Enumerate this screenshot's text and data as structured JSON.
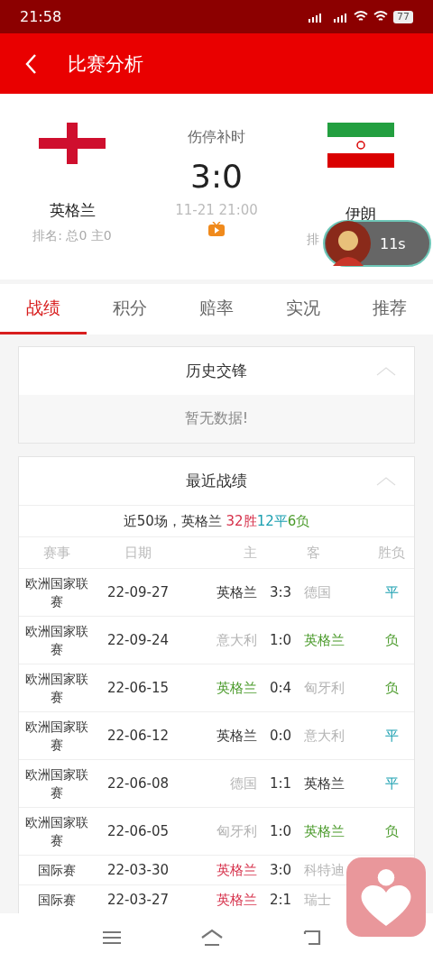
{
  "status_bar": {
    "time": "21:58",
    "battery": "77"
  },
  "header": {
    "title": "比赛分析"
  },
  "match": {
    "home": {
      "name": "英格兰",
      "rank": "排名: 总0  主0"
    },
    "away": {
      "name": "伊朗",
      "rank": "排"
    },
    "status": "伤停补时",
    "score": "3:0",
    "time": "11-21 21:00"
  },
  "floating_bubble": {
    "label": "11s"
  },
  "tabs": [
    {
      "label": "战绩",
      "selected": true
    },
    {
      "label": "积分",
      "selected": false
    },
    {
      "label": "赔率",
      "selected": false
    },
    {
      "label": "实况",
      "selected": false
    },
    {
      "label": "推荐",
      "selected": false
    }
  ],
  "history": {
    "title": "历史交锋",
    "expanded": true,
    "empty_text": "暂无数据!"
  },
  "recent": {
    "title": "最近战绩",
    "expanded": true,
    "summary": [
      {
        "text": "近50场，英格兰 ",
        "color": "#333333"
      },
      {
        "text": "32胜",
        "color": "#d6304a"
      },
      {
        "text": "12平",
        "color": "#1a9fb0"
      },
      {
        "text": "6负",
        "color": "#4a9a2a"
      }
    ],
    "columns": [
      "赛事",
      "日期",
      "主",
      "客",
      "胜负"
    ],
    "rows": [
      {
        "league": "欧洲国家联赛",
        "date": "22-09-27",
        "home": {
          "name": "英格兰",
          "color": "#333333"
        },
        "score": "3:3",
        "away": {
          "name": "德国",
          "color": "#b5b5b5"
        },
        "result": {
          "text": "平",
          "color": "#1a9fb0"
        }
      },
      {
        "league": "欧洲国家联赛",
        "date": "22-09-24",
        "home": {
          "name": "意大利",
          "color": "#b5b5b5"
        },
        "score": "1:0",
        "away": {
          "name": "英格兰",
          "color": "#4a9a2a"
        },
        "result": {
          "text": "负",
          "color": "#4a9a2a"
        }
      },
      {
        "league": "欧洲国家联赛",
        "date": "22-06-15",
        "home": {
          "name": "英格兰",
          "color": "#4a9a2a"
        },
        "score": "0:4",
        "away": {
          "name": "匈牙利",
          "color": "#b5b5b5"
        },
        "result": {
          "text": "负",
          "color": "#4a9a2a"
        }
      },
      {
        "league": "欧洲国家联赛",
        "date": "22-06-12",
        "home": {
          "name": "英格兰",
          "color": "#333333"
        },
        "score": "0:0",
        "away": {
          "name": "意大利",
          "color": "#b5b5b5"
        },
        "result": {
          "text": "平",
          "color": "#1a9fb0"
        }
      },
      {
        "league": "欧洲国家联赛",
        "date": "22-06-08",
        "home": {
          "name": "德国",
          "color": "#b5b5b5"
        },
        "score": "1:1",
        "away": {
          "name": "英格兰",
          "color": "#333333"
        },
        "result": {
          "text": "平",
          "color": "#1a9fb0"
        }
      },
      {
        "league": "欧洲国家联赛",
        "date": "22-06-05",
        "home": {
          "name": "匈牙利",
          "color": "#b5b5b5"
        },
        "score": "1:0",
        "away": {
          "name": "英格兰",
          "color": "#4a9a2a"
        },
        "result": {
          "text": "负",
          "color": "#4a9a2a"
        }
      },
      {
        "league": "国际赛",
        "date": "22-03-30",
        "home": {
          "name": "英格兰",
          "color": "#d6304a"
        },
        "score": "3:0",
        "away": {
          "name": "科特迪",
          "color": "#b5b5b5"
        }
      },
      {
        "league": "国际赛",
        "date": "22-03-27",
        "home": {
          "name": "英格兰",
          "color": "#d6304a"
        },
        "score": "2:1",
        "away": {
          "name": "瑞士",
          "color": "#b5b5b5"
        }
      }
    ]
  }
}
